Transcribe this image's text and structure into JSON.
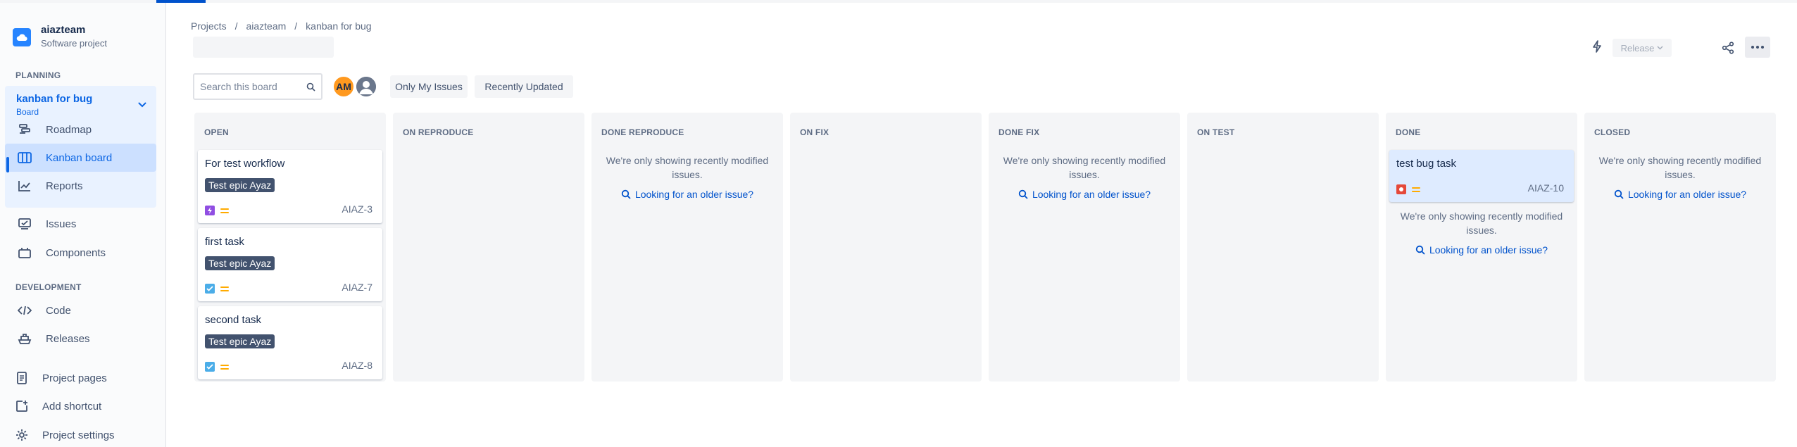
{
  "project": {
    "name": "aiazteam",
    "type": "Software project"
  },
  "sidebar": {
    "planning_title": "PLANNING",
    "board_name": "kanban for bug",
    "board_sub": "Board",
    "items": [
      {
        "label": "Roadmap"
      },
      {
        "label": "Kanban board"
      },
      {
        "label": "Reports"
      },
      {
        "label": "Issues"
      },
      {
        "label": "Components"
      }
    ],
    "development_title": "DEVELOPMENT",
    "dev_items": [
      {
        "label": "Code"
      },
      {
        "label": "Releases"
      }
    ],
    "footer_items": [
      {
        "label": "Project pages"
      },
      {
        "label": "Add shortcut"
      },
      {
        "label": "Project settings"
      }
    ]
  },
  "breadcrumb": [
    "Projects",
    "/",
    "aiazteam",
    "/",
    "kanban for bug"
  ],
  "toolbar": {
    "release_label": "Release",
    "search_placeholder": "Search this board",
    "avatar_initials": "AM",
    "filter_only_mine": "Only My Issues",
    "filter_recent": "Recently Updated"
  },
  "notice_text": "We're only showing recently modified issues.",
  "older_link": "Looking for an older issue?",
  "columns": [
    {
      "title": "OPEN",
      "cards": [
        {
          "title": "For test workflow",
          "epic": "Test epic Ayaz",
          "key": "AIAZ-3",
          "type": "epic"
        },
        {
          "title": "first task",
          "epic": "Test epic Ayaz",
          "key": "AIAZ-7",
          "type": "task"
        },
        {
          "title": "second task",
          "epic": "Test epic Ayaz",
          "key": "AIAZ-8",
          "type": "task"
        }
      ]
    },
    {
      "title": "ON REPRODUCE"
    },
    {
      "title": "DONE REPRODUCE"
    },
    {
      "title": "ON FIX"
    },
    {
      "title": "DONE FIX"
    },
    {
      "title": "ON TEST"
    },
    {
      "title": "DONE",
      "cards": [
        {
          "title": "test bug task",
          "key": "AIAZ-10",
          "type": "bug"
        }
      ]
    },
    {
      "title": "CLOSED"
    }
  ],
  "colors": {
    "accent": "#0052cc",
    "epic_label_bg": "#42526e",
    "priority_medium": "#ffab00",
    "bug_red": "#e5493a",
    "task_blue": "#4bade8",
    "epic_purple": "#904ee2"
  }
}
